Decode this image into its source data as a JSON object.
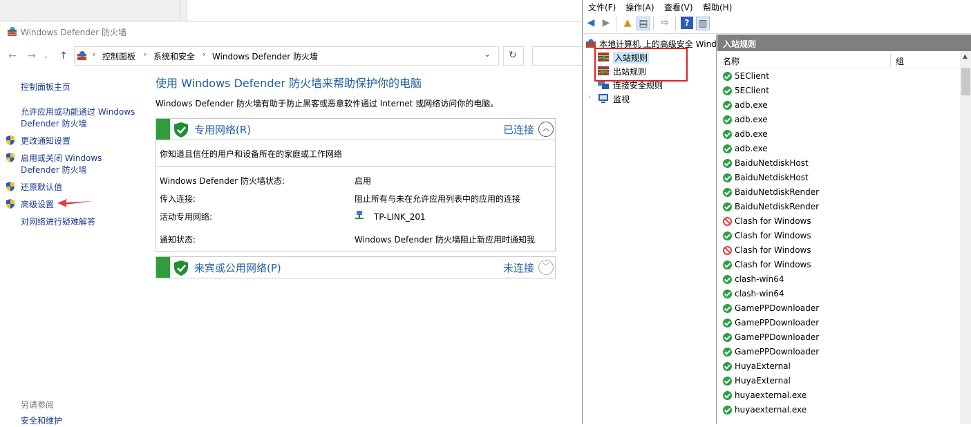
{
  "control_panel": {
    "window_title": "Windows Defender 防火墙",
    "breadcrumb": [
      "控制面板",
      "系统和安全",
      "Windows Defender 防火墙"
    ],
    "sidebar": {
      "home": "控制面板主页",
      "allow_app": "允许应用或功能通过 Windows Defender 防火墙",
      "change_notify": "更改通知设置",
      "toggle": "启用或关闭 Windows Defender 防火墙",
      "restore": "还原默认值",
      "advanced": "高级设置",
      "troubleshoot": "对网络进行疑难解答",
      "see_also": "另请参阅",
      "security_maintenance": "安全和维护"
    },
    "heading": "使用 Windows Defender 防火墙来帮助保护你的电脑",
    "description": "Windows Defender 防火墙有助于防止黑客或恶意软件通过 Internet 或网络访问你的电脑。",
    "private_network": {
      "title": "专用网络(R)",
      "status": "已连接",
      "subtitle": "你知道且信任的用户和设备所在的家庭或工作网络",
      "rows": {
        "fw_state_label": "Windows Defender 防火墙状态:",
        "fw_state_value": "启用",
        "incoming_label": "传入连接:",
        "incoming_value": "阻止所有与未在允许应用列表中的应用的连接",
        "active_label": "活动专用网络:",
        "active_value": "TP-LINK_201",
        "notify_label": "通知状态:",
        "notify_value": "Windows Defender 防火墙阻止新应用时通知我"
      }
    },
    "public_network": {
      "title": "来宾或公用网络(P)",
      "status": "未连接"
    }
  },
  "mmc": {
    "menu": [
      "文件(F)",
      "操作(A)",
      "查看(V)",
      "帮助(H)"
    ],
    "tree": {
      "root": "本地计算机 上的高级安全 Windows",
      "inbound": "入站规则",
      "outbound": "出站规则",
      "connection_security": "连接安全规则",
      "monitoring": "监视"
    },
    "list_title": "入站规则",
    "columns": [
      "名称",
      "组"
    ],
    "rules": [
      {
        "name": "5EClient",
        "status": "allow"
      },
      {
        "name": "5EClient",
        "status": "allow"
      },
      {
        "name": "adb.exe",
        "status": "allow"
      },
      {
        "name": "adb.exe",
        "status": "allow"
      },
      {
        "name": "adb.exe",
        "status": "allow"
      },
      {
        "name": "adb.exe",
        "status": "allow"
      },
      {
        "name": "BaiduNetdiskHost",
        "status": "allow"
      },
      {
        "name": "BaiduNetdiskHost",
        "status": "allow"
      },
      {
        "name": "BaiduNetdiskRender",
        "status": "allow"
      },
      {
        "name": "BaiduNetdiskRender",
        "status": "allow"
      },
      {
        "name": "Clash for Windows",
        "status": "block"
      },
      {
        "name": "Clash for Windows",
        "status": "allow"
      },
      {
        "name": "Clash for Windows",
        "status": "block"
      },
      {
        "name": "Clash for Windows",
        "status": "allow"
      },
      {
        "name": "clash-win64",
        "status": "allow"
      },
      {
        "name": "clash-win64",
        "status": "allow"
      },
      {
        "name": "GamePPDownloader",
        "status": "allow"
      },
      {
        "name": "GamePPDownloader",
        "status": "allow"
      },
      {
        "name": "GamePPDownloader",
        "status": "allow"
      },
      {
        "name": "GamePPDownloader",
        "status": "allow"
      },
      {
        "name": "HuyaExternal",
        "status": "allow"
      },
      {
        "name": "HuyaExternal",
        "status": "allow"
      },
      {
        "name": "huyaexternal.exe",
        "status": "allow"
      },
      {
        "name": "huyaexternal.exe",
        "status": "allow"
      }
    ]
  }
}
